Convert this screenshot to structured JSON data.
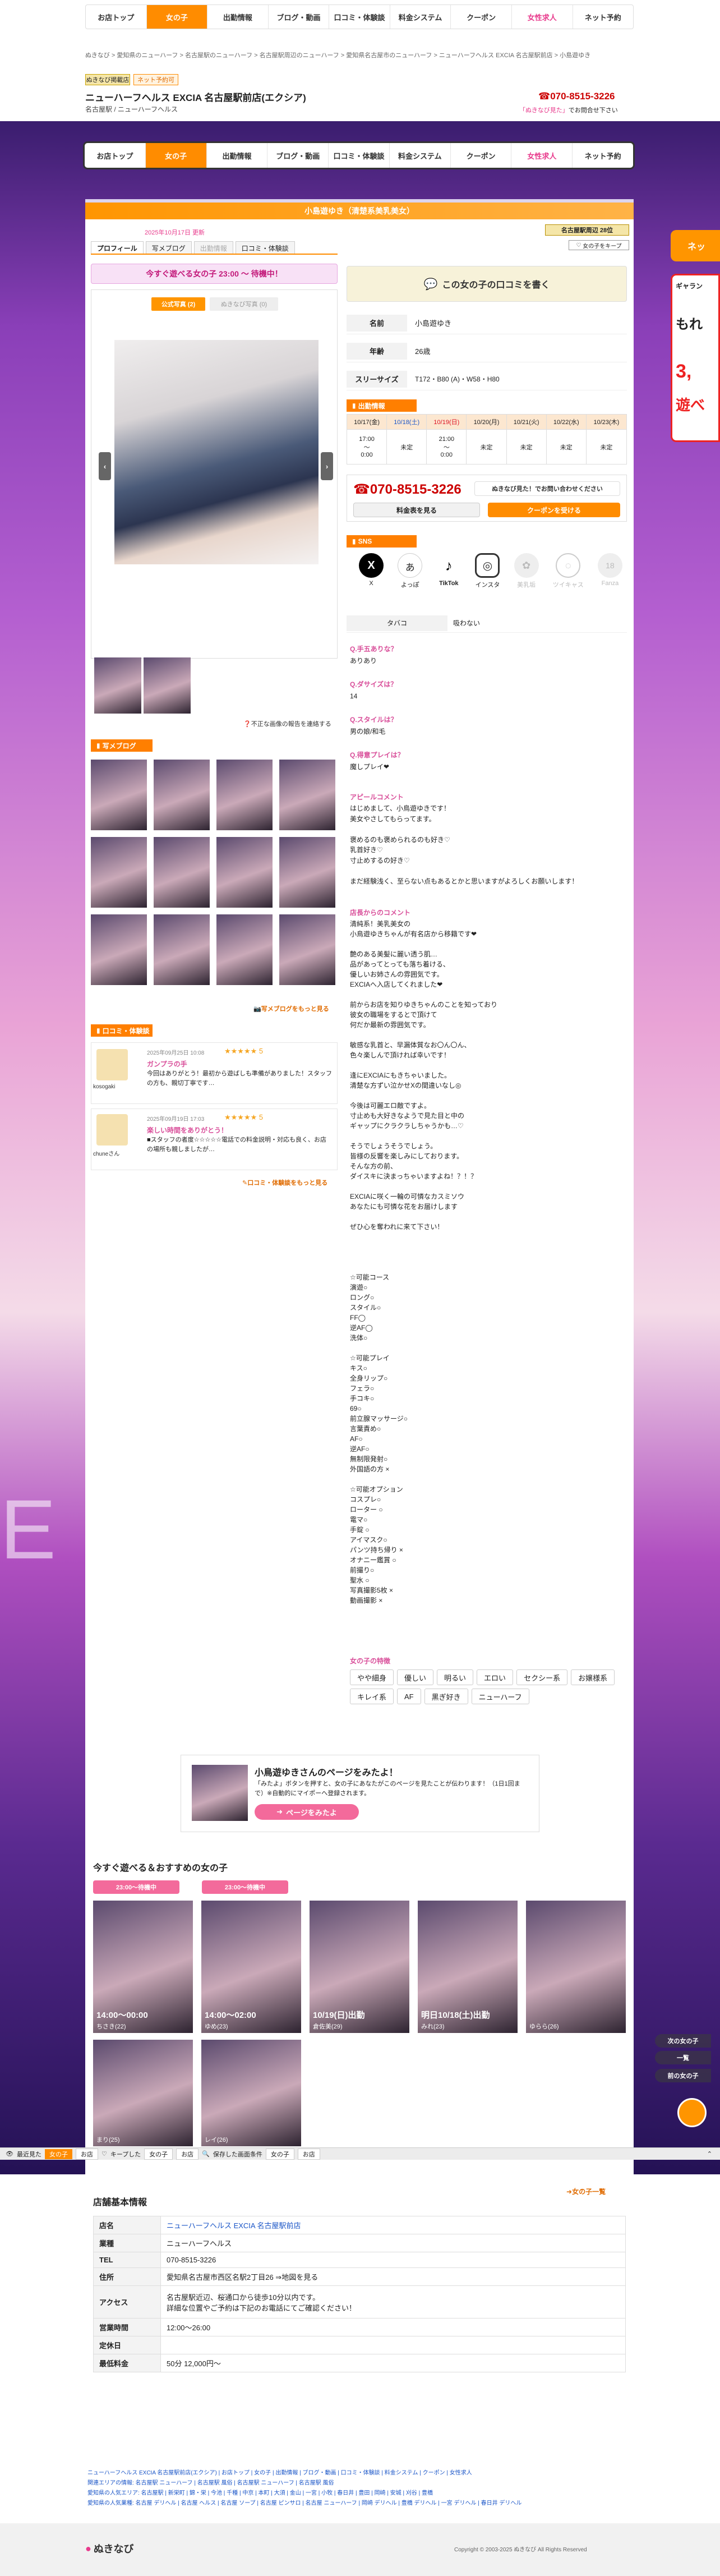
{
  "nav": {
    "items": [
      "お店トップ",
      "女の子",
      "出勤情報",
      "ブログ・動画",
      "口コミ・体験談",
      "料金システム",
      "クーポン",
      "女性求人",
      "ネット予約"
    ]
  },
  "breadcrumb": "ぬきなび > 愛知県のニューハーフ > 名古屋駅のニューハーフ > 名古屋駅周辺のニューハーフ > 愛知県名古屋市のニューハーフ > ニューハーフヘルス EXCIA 名古屋駅前店 > 小島遊ゆき",
  "shop": {
    "badge1": "ぬきなび掲載店",
    "badge2": "ネット予約可",
    "name": "ニューハーフヘルス EXCIA 名古屋駅前店(エクシア)",
    "sub": "名古屋駅 / ニューハーフヘルス",
    "tel": "070-8515-3226",
    "note_pink": "「ぬきなび見た」",
    "note": "でお問合せ下さい"
  },
  "profile": {
    "title": "小島遊ゆき（清楚系美乳美女）",
    "update": "2025年10月17日 更新",
    "rank_badge": "名古屋駅周辺 28位",
    "keep_label": "女の子をキープ",
    "tabs": [
      "プロフィール",
      "写メブログ",
      "出勤情報",
      "口コミ・体験談"
    ],
    "today": "今すぐ遊べる女の子 23:00 〜 待機中！",
    "photo_tabs": [
      "公式写真 (2)",
      "ぬきなび写真 (0)"
    ],
    "photo_report": "不正な画像の報告を連絡する",
    "review_btn": "この女の子の口コミを書く"
  },
  "info": {
    "rows": [
      {
        "k": "名前",
        "v": "小島遊ゆき"
      },
      {
        "k": "年齢",
        "v": "26歳"
      },
      {
        "k": "スリーサイズ",
        "v": "T172・B80 (A)・W58・H80"
      }
    ]
  },
  "schedule": {
    "title": "出勤情報",
    "days": [
      "10/17(金)",
      "10/18(土)",
      "10/19(日)",
      "10/20(月)",
      "10/21(火)",
      "10/22(水)",
      "10/23(木)"
    ],
    "times": [
      "17:00\n〜\n0:00",
      "未定",
      "21:00\n〜\n0:00",
      "未定",
      "未定",
      "未定",
      "未定"
    ]
  },
  "contact": {
    "tel": "070-8515-3226",
    "pink_btn": "ぬきなび見た！でお問い合わせください",
    "price_btn": "料金表を見る",
    "coupon_btn": "クーポンを受ける"
  },
  "sns": {
    "title": "SNS",
    "items": [
      "X",
      "よっぽ",
      "TikTok",
      "インスタ",
      "美乳垢",
      "ツイキャス",
      "Fanza"
    ]
  },
  "tobacco": {
    "k": "タバコ",
    "v": "吸わない"
  },
  "qa": [
    {
      "q": "Q.手五ありな？",
      "a": "ありあり"
    },
    {
      "q": "Q.ダサイズは？",
      "a": "14"
    },
    {
      "q": "Q.スタイルは？",
      "a": "男の娘/和毛"
    },
    {
      "q": "Q.得意プレイは？",
      "a": "魔しプレイ❤"
    }
  ],
  "appeal": {
    "title": "アピールコメント",
    "body": "はじめまして、小鳥遊ゆきです！\n美女やさしてもらってます。\n\n褒めるのも褒められるのも好き♡\n乳首好き♡\n寸止めするの好き♡\n\nまだ経験浅く、至らない点もあるとかと思いますがよろしくお願いします！"
  },
  "shop_comment": {
    "title": "店長からのコメント",
    "body": "清純系！美乳美女の\n小鳥遊ゆきちゃんが有名店から移籍です❤\n\n艶のある美髪に麗い透う肌…\n品があってとっても落ち着ける、\n優しいお姉さんの雰囲気です。\nEXCIAへ入店してくれました❤\n\n前からお店を知りゆきちゃんのことを知っており\n彼女の職場をするとで頂けて\n何だか最新の雰囲気です。\n\n敏感な乳首と、早漏体質なお〇ん〇ん、\n色々楽しんで頂ければ幸いです！\n\n逢にEXCIAにもきちゃいました。\n清楚な方ずい泣かせXの間違いなし◎\n\n今後は可麗エロ敵ですよ。\n寸止めも大好きなようで見た目と中の\nギャップにクラクラしちゃうかも…♡\n\nそうでしょうそうでしょう。\n皆様の反響を楽しみにしております。\nそんな方の前、\nダイスキに決まっちゃいますよね！？！？\n\nEXCIAに咲く一輪の可憐なカスミソウ\nあなたにも可憐な花をお届けします\n\nぜひ心を奪われに来て下さい！"
  },
  "options": {
    "body": "☆可能コース\n演遊○\nロング○\nスタイル○\nFF◯\n逆AF◯\n洗体○\n\n☆可能プレイ\nキス○\n全身リップ○\nフェラ○\n手コキ○\n69○\n前立腺マッサージ○\n言葉責め○\nAF○\n逆AF○\n無制限発射○\n外国語の方 ×\n\n☆可能オプション\nコスプレ○\nローター ○\n電マ○\n手錠 ○\nアイマスク○\nパンツ持ち帰り ×\nオナニー鑑賞 ○\n前撮り○\n聖水 ○\n写真撮影5枚 ×\n動画撮影 ×"
  },
  "features": {
    "title": "女の子の特徴",
    "tags": [
      "やや細身",
      "優しい",
      "明るい",
      "エロい",
      "セクシー系",
      "お嬢様系",
      "キレイ系",
      "AF",
      "黒ぎ好き",
      "ニューハーフ"
    ]
  },
  "blog": {
    "title": "写メブログ",
    "more": "写メブログをもっと見る"
  },
  "reviews": {
    "title": "口コミ・体験談",
    "items": [
      {
        "user": "kosogaki",
        "date": "2025年09月25日 10:08",
        "stars": "★★★★★ 5",
        "title": "ガンプラの手",
        "body": "今回はありがとう！最初から遊ばしも準備がありました！スタッフの方も、親切丁寧です…"
      },
      {
        "user": "chuneさん",
        "date": "2025年09月19日 17:03",
        "stars": "★★★★★ 5",
        "title": "楽しい時間をありがとう！",
        "body": "■スタッフの者度☆☆☆☆☆電話での料金説明・対応も良く、お店の場所も親しましたが…"
      }
    ],
    "more": "口コミ・体験談をもっと見る"
  },
  "myna": {
    "title": "小鳥遊ゆきさんのページをみたよ！",
    "body": "「みたよ」ボタンを押すと、女の子にあなたがこのページを見たことが伝わります！（1日1回まで）※自動的にマイポーへ登録されます。",
    "btn": "ページをみたよ"
  },
  "recommend": {
    "title": "今すぐ遊べる＆おすすめの女の子",
    "badges": [
      "23:00〜待機中",
      "23:00〜待機中"
    ],
    "cards": [
      {
        "time": "14:00〜00:00",
        "name": "ちさき(22)"
      },
      {
        "time": "14:00〜02:00",
        "name": "ゆめ(23)"
      },
      {
        "time": "10/19(日)出勤",
        "name": "倉佐美(29)"
      },
      {
        "time": "明日10/18(土)出勤",
        "name": "みれ(23)"
      },
      {
        "time": "",
        "name": "ゆらら(26)"
      },
      {
        "time": "",
        "name": "まり(25)"
      },
      {
        "time": "",
        "name": "レイ(26)"
      }
    ]
  },
  "footer_bar": {
    "items": [
      "最近見た",
      "女の子",
      "お店",
      "キープした",
      "女の子",
      "お店",
      "保存した画面条件",
      "女の子",
      "お店"
    ]
  },
  "store": {
    "title": "店舗基本情報",
    "more": "女の子一覧",
    "rows": [
      {
        "k": "店名",
        "v": "ニューハーフヘルス EXCIA 名古屋駅前店"
      },
      {
        "k": "業種",
        "v": "ニューハーフヘルス"
      },
      {
        "k": "TEL",
        "v": "070-8515-3226"
      },
      {
        "k": "住所",
        "v": "愛知県名古屋市西区名駅2丁目26 ⇒地図を見る"
      },
      {
        "k": "アクセス",
        "v": "名古屋駅近辺、桜通口から徒歩10分以内です。\n詳細な位置やご予約は下記のお電話にてご確認ください！"
      },
      {
        "k": "営業時間",
        "v": "12:00〜26:00"
      },
      {
        "k": "定休日",
        "v": ""
      },
      {
        "k": "最低料金",
        "v": "50分 12,000円〜"
      }
    ]
  },
  "links": {
    "line1": "ニューハーフヘルス EXCIA 名古屋駅前店(エクシア) | お店トップ | 女の子 | 出勤情報 | ブログ・動画 | 口コミ・体験談 | 料金システム | クーポン | 女性求人",
    "line2": "関連エリアの情報: 名古屋駅 ニューハーフ | 名古屋駅 風俗 | 名古屋駅 ニューハーフ | 名古屋駅 風俗",
    "line3": "愛知県の人気エリア: 名古屋駅 | 新栄町 | 錦・栄 | 今池 | 千種 | 中京 | 本町 | 大須 | 金山 | 一宮 | 小牧 | 春日井 | 豊田 | 岡崎 | 安城 | 刈谷 | 豊橋",
    "line4": "愛知県の人気業種: 名古屋 デリヘル | 名古屋 ヘルス | 名古屋 ソープ | 名古屋 ピンサロ | 名古屋 ニューハーフ | 岡崎 デリヘル | 豊橋 デリヘル | 一宮 デリヘル | 春日井 デリヘル"
  },
  "copyright": "Copyright © 2003-2025 ぬきなび All Rights Reserved",
  "logo": "ぬきなび",
  "side": {
    "net": "ネッ",
    "ad1": "ギャラン",
    "ad2": "もれ",
    "ad3": "3,",
    "ad4": "遊べ",
    "top_btn": "次の女の子",
    "list_btn": "一覧",
    "prev_btn": "前の女の子"
  },
  "colors": {
    "accent": "#ff8c00",
    "pink": "#e83a8c"
  }
}
